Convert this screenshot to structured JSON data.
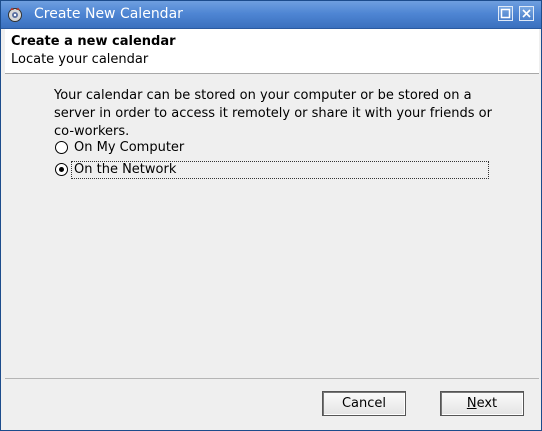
{
  "window": {
    "title": "Create New Calendar"
  },
  "header": {
    "title": "Create a new calendar",
    "subtitle": "Locate your calendar"
  },
  "content": {
    "description": "Your calendar can be stored on your computer or be stored on a server in order to access it remotely or share it with your friends or co-workers.",
    "options": [
      {
        "label": "On My Computer",
        "selected": false
      },
      {
        "label": "On the Network",
        "selected": true
      }
    ]
  },
  "buttons": {
    "cancel": "Cancel",
    "next_mnemonic": "N",
    "next_rest": "ext"
  },
  "icons": {
    "app": "calendar-app-icon",
    "maximize": "maximize-icon",
    "close": "close-icon"
  },
  "colors": {
    "titlebar": "#4f86d4",
    "header_bg": "#ffffff",
    "dialog_bg": "#efefef"
  }
}
